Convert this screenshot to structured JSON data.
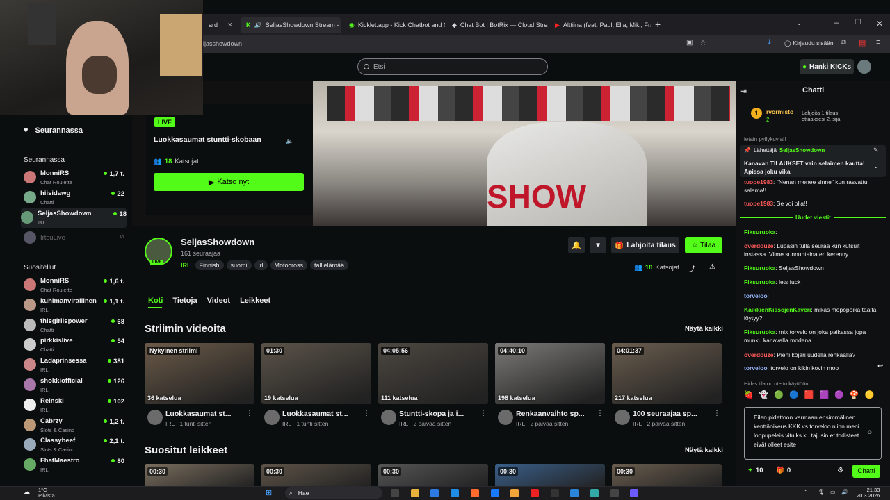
{
  "browser": {
    "tabs": [
      {
        "label": "ard",
        "active": false
      },
      {
        "label": "SeljasShowdown Stream - •",
        "active": true
      },
      {
        "label": "Kicklet.app - Kick Chatbot and C",
        "active": false
      },
      {
        "label": "Chat Bot | BotRix — Cloud Strea",
        "active": false
      },
      {
        "label": "Alttiina (feat. Paul, Elia, Miki, Fra",
        "active": false
      }
    ],
    "url": "ljasshowdown",
    "signin_label": "Kirjaudu sisään"
  },
  "header": {
    "search_placeholder": "Etsi",
    "kicks_label": "Hanki KICKs"
  },
  "sidebar": {
    "partial_label": "Selaa",
    "following_label": "Seurannassa",
    "following_heading": "Seurannassa",
    "following": [
      {
        "name": "MonniRS",
        "category": "Chat Roulette",
        "viewers": "1,7 t.",
        "color": "#c77"
      },
      {
        "name": "hiisidawg",
        "category": "Chatti",
        "viewers": "22",
        "color": "#7a8"
      },
      {
        "name": "SeljasShowdown",
        "category": "IRL",
        "viewers": "18",
        "color": "#697"
      },
      {
        "name": "IrtsuLive",
        "category": "",
        "viewers": "",
        "color": "#556"
      }
    ],
    "recommended_heading": "Suositellut",
    "recommended": [
      {
        "name": "MonniRS",
        "category": "Chat Roulette",
        "viewers": "1,6 t.",
        "color": "#c77"
      },
      {
        "name": "kuhlmanvirallinen",
        "category": "IRL",
        "viewers": "1,1 t.",
        "color": "#b98"
      },
      {
        "name": "thisgirlispower",
        "category": "Chatti",
        "viewers": "68",
        "color": "#bbb"
      },
      {
        "name": "pirkkislive",
        "category": "Chatti",
        "viewers": "54",
        "color": "#ccc"
      },
      {
        "name": "Ladaprinsessa",
        "category": "IRL",
        "viewers": "381",
        "color": "#c88"
      },
      {
        "name": "shokkiofficial",
        "category": "IRL",
        "viewers": "126",
        "color": "#a7a"
      },
      {
        "name": "Reinski",
        "category": "IRL",
        "viewers": "102",
        "color": "#eee"
      },
      {
        "name": "Cabrzy",
        "category": "Slots & Casino",
        "viewers": "1,2 t.",
        "color": "#b97"
      },
      {
        "name": "Classybeef",
        "category": "Slots & Casino",
        "viewers": "2,1 t.",
        "color": "#9ab"
      },
      {
        "name": "FhatMaestro",
        "category": "IRL",
        "viewers": "80",
        "color": "#6a6"
      }
    ]
  },
  "hero": {
    "live_label": "LIVE",
    "title": "Luokkasaumat stuntti-skobaan",
    "viewers": "18",
    "viewers_label": "Katsojat",
    "watch_label": "Katso nyt"
  },
  "channel": {
    "name": "SeljasShowdown",
    "followers": "161 seuraajaa",
    "category": "IRL",
    "tags": [
      "Finnish",
      "suomi",
      "irl",
      "Motocross",
      "tallielämää"
    ],
    "gift_label": "Lahjoita tilaus",
    "subscribe_label": "Tilaa",
    "viewers": "18",
    "viewers_label": "Katsojat",
    "avatar_live": "LIVE"
  },
  "tabs": [
    "Koti",
    "Tietoja",
    "Videot",
    "Leikkeet"
  ],
  "videos_section": {
    "title": "Striimin videoita",
    "see_all": "Näytä kaikki",
    "items": [
      {
        "duration": "Nykyinen striimi",
        "views": "36 katselua",
        "title": "Luokkasaumat st...",
        "meta": "IRL · 1 tunti sitten",
        "bg": "#6b5a48"
      },
      {
        "duration": "01:30",
        "views": "19 katselua",
        "title": "Luokkasaumat st...",
        "meta": "IRL · 1 tunti sitten",
        "bg": "#5b5349"
      },
      {
        "duration": "04:05:56",
        "views": "111 katselua",
        "title": "Stuntti-skopa ja i...",
        "meta": "IRL · 2 päivää sitten",
        "bg": "#4c4740"
      },
      {
        "duration": "04:40:10",
        "views": "198 katselua",
        "title": "Renkaanvaihto sp...",
        "meta": "IRL · 2 päivää sitten",
        "bg": "#7c7a78"
      },
      {
        "duration": "04:01:37",
        "views": "217 katselua",
        "title": "100 seuraajaa sp...",
        "meta": "IRL · 2 päivää sitten",
        "bg": "#6a5d4e"
      }
    ]
  },
  "clips_section": {
    "title": "Suositut leikkeet",
    "see_all": "Näytä kaikki",
    "items": [
      {
        "duration": "00:30",
        "bg": "#7a6e5e"
      },
      {
        "duration": "00:30",
        "bg": "#5e5448"
      },
      {
        "duration": "00:30",
        "bg": "#555"
      },
      {
        "duration": "00:30",
        "bg": "#3a5f8a"
      },
      {
        "duration": "00:30",
        "bg": "#6a5d4e"
      }
    ]
  },
  "chat": {
    "title": "Chatti",
    "top_gifter": "rvormisto",
    "top_gifter_count": "2",
    "top_gifter_note": "Lahjoita 1 tilaus ottaaksesi 2. sija",
    "pinned_sender_label": "Lähettäjä",
    "pinned_sender": "SeljasShowdown",
    "pinned_text": "Kanavan TILAUKSET vain selaimen kautta! Apissa joku vika",
    "partial_1": "ietain pyllykuvia!!",
    "partial_2_user": "tuope1983",
    "partial_2_text": ": \"Nenan menee sinne\" kun rasvattu salama!!",
    "line_3_user": "tuope1983",
    "line_3_text": ": Se voi olla!!",
    "new_messages_label": "Uudet viestit",
    "messages": [
      {
        "user": "Fiksuruoka",
        "text": ":",
        "cls": "u1"
      },
      {
        "user": "overdouze",
        "text": ": Lupasin tulla seuraa kun kutsuit instassa. Viime sunnuntaina en kerenny",
        "cls": "u2"
      },
      {
        "user": "Fiksuruoka",
        "text": ": SeljasShowdown",
        "cls": "u1"
      },
      {
        "user": "Fiksuruoka",
        "text": ": lets fuck",
        "cls": "u1"
      },
      {
        "user": "torveloo",
        "text": ":",
        "cls": "u4"
      },
      {
        "user": "KaikkienKissojenKaveri",
        "text": ": mikäs mopopoika täältä löytyy?",
        "cls": "u1"
      },
      {
        "user": "Fiksuruoka",
        "text": ": mix torvelo on joka paikassa jopa munku kanavalla modena",
        "cls": "u1"
      },
      {
        "user": "overdouze",
        "text": ": Pieni kojari uudella renkaalla?",
        "cls": "u2"
      },
      {
        "user": "torveloo",
        "text": ": torvelo on kikin kovin moo",
        "cls": "u4"
      }
    ],
    "slow_mode": "Hidas tila on otettu käyttöön.",
    "input_text": "Eilen pidettoon varmaan ensimmälinen kenttäoikeus KKK vs torveloo niihn meni loppupeleis vituiks ku tajusin et todisteet eivät olleet esite",
    "points": "10",
    "gifts": "0",
    "send_label": "Chatti"
  },
  "taskbar": {
    "weather_temp": "1°C",
    "weather_desc": "Pilvistä",
    "search_label": "Hae",
    "time": "21.33",
    "date": "20.3.2026"
  }
}
